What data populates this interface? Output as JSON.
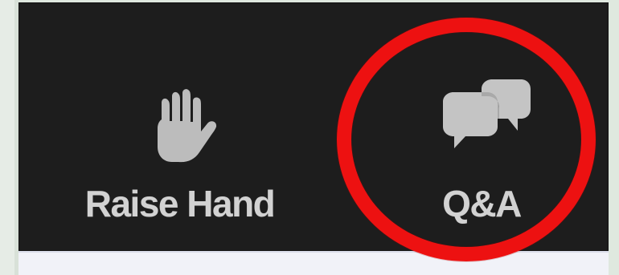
{
  "toolbar": {
    "raise_hand": {
      "label": "Raise Hand",
      "icon": "raise-hand-icon"
    },
    "qa": {
      "label": "Q&A",
      "icon": "qa-chat-icon"
    }
  },
  "colors": {
    "toolbar_background": "#1d1d1d",
    "toolbar_text": "#d2d2d2",
    "icon_gray": "#bcbcbc",
    "highlight_red": "#ed1111",
    "page_background": "#dfe8df",
    "lower_strip": "#f1f2f8"
  }
}
